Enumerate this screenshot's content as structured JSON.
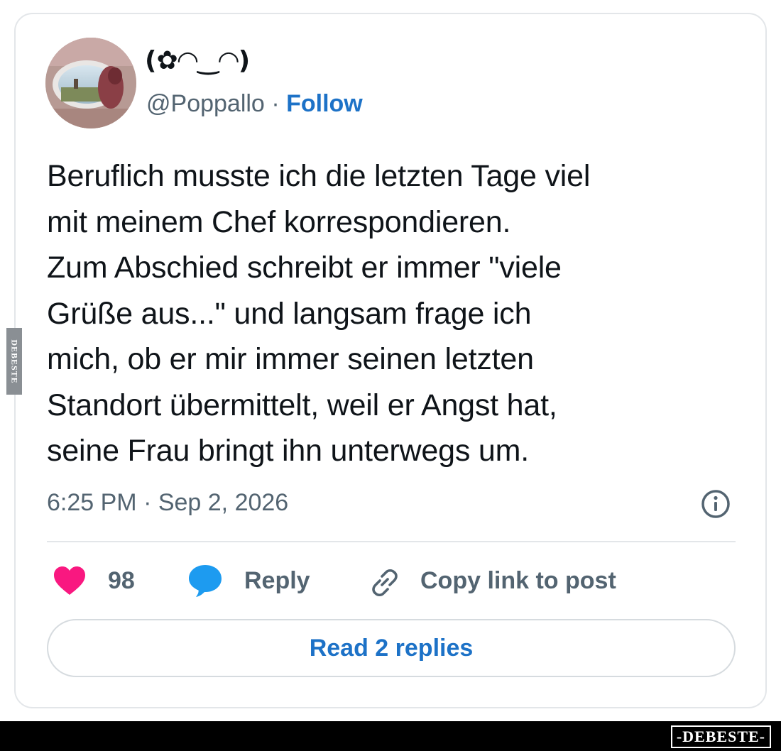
{
  "author": {
    "display_name": "(✿◠‿◠)",
    "handle": "@Poppallo",
    "separator": "·",
    "follow_label": "Follow"
  },
  "tweet": {
    "text": "Beruflich musste ich die letzten Tage viel\nmit meinem Chef korrespondieren.\nZum Abschied schreibt er immer \"viele\nGrüße aus...\" und langsam frage ich\nmich, ob er mir immer seinen letzten\nStandort übermittelt, weil er Angst hat,\nseine Frau bringt ihn unterwegs um.",
    "timestamp": "6:25 PM · Sep 2, 2026"
  },
  "actions": {
    "like_count": "98",
    "reply_label": "Reply",
    "copy_link_label": "Copy link to post",
    "read_replies_label": "Read 2 replies"
  },
  "watermark": {
    "side_text": "DEBESTE",
    "bottom_text": "-DEBESTE-"
  },
  "colors": {
    "like_pink": "#f91880",
    "reply_blue": "#1d9bf0",
    "link_blue": "#1d72c7",
    "secondary_text": "#536471",
    "primary_text": "#0f1419"
  },
  "icons": {
    "like": "heart-icon",
    "reply": "speech-bubble-icon",
    "copy": "link-icon",
    "info": "info-icon"
  }
}
